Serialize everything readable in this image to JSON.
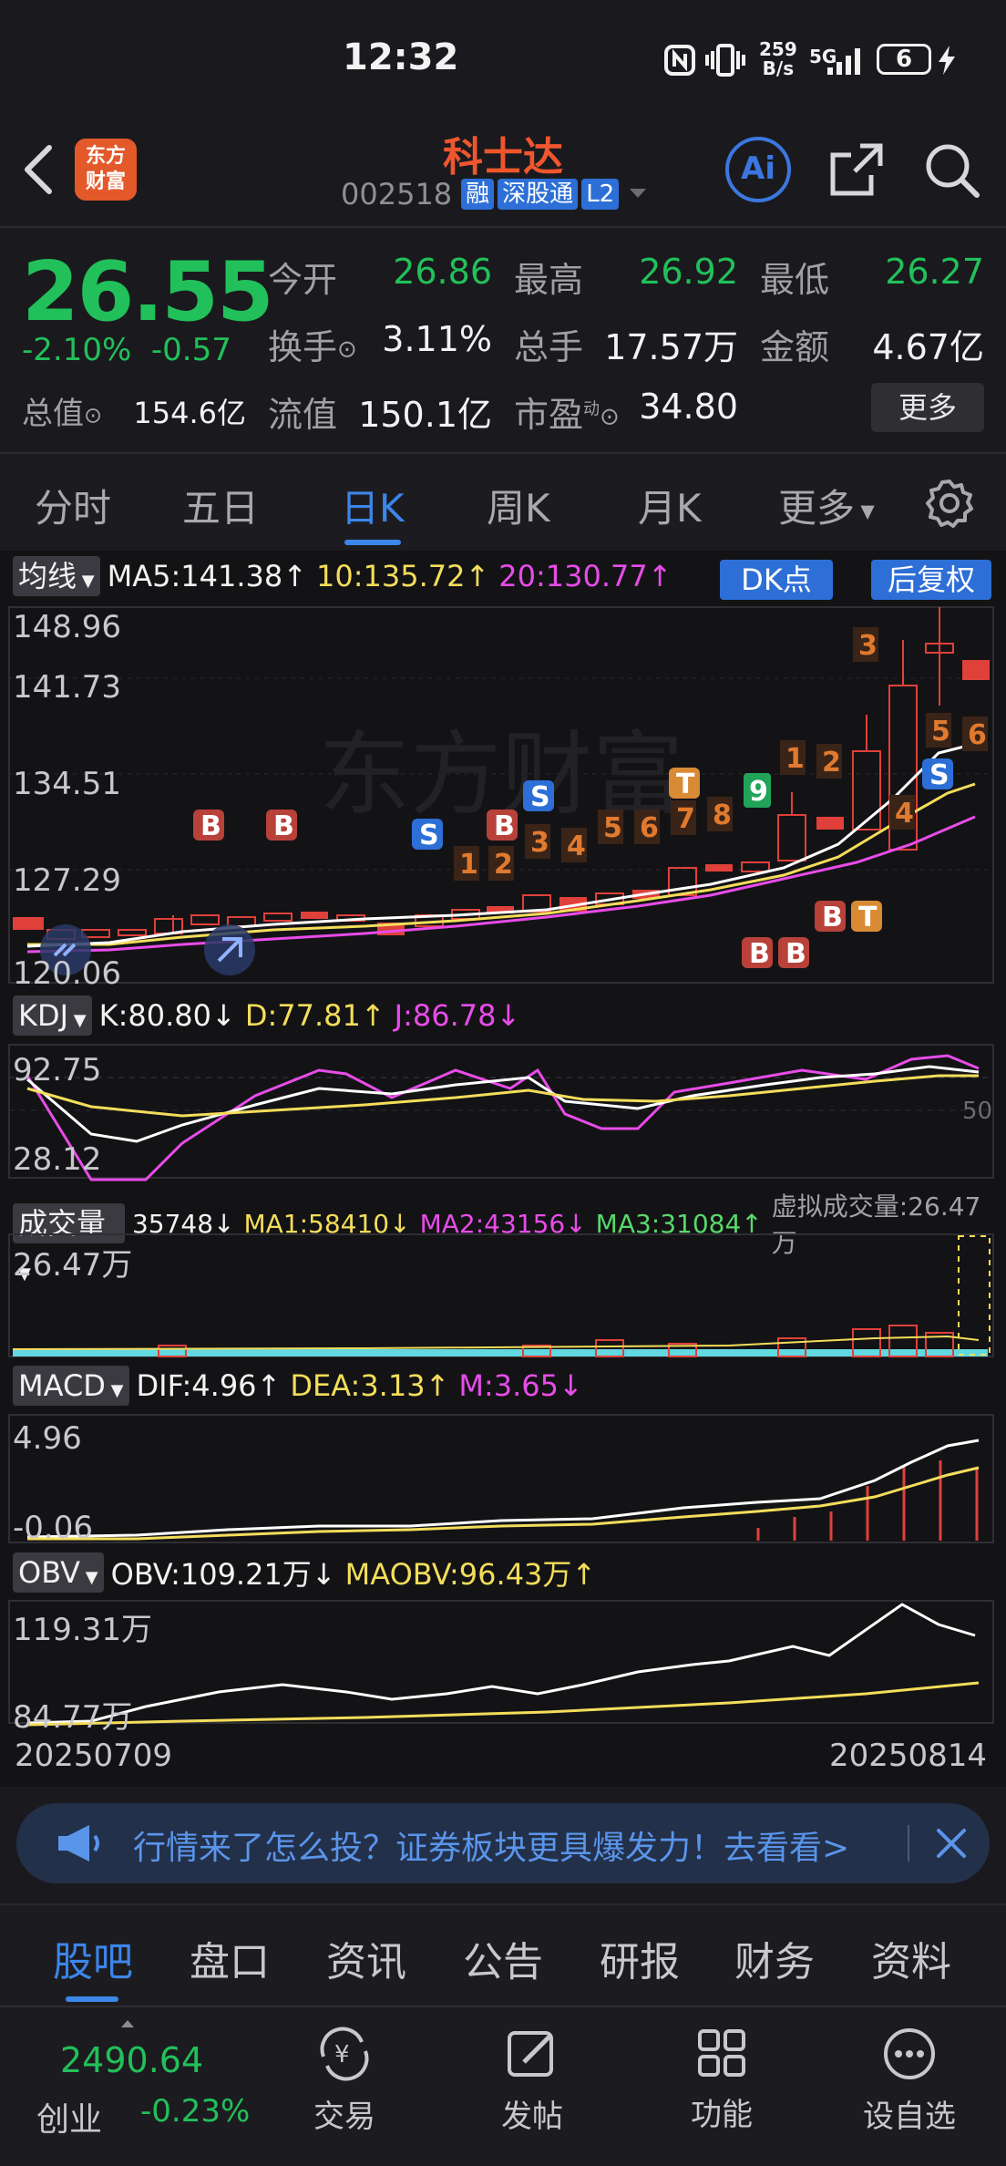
{
  "status": {
    "time": "12:32",
    "netspeed_value": "259",
    "netspeed_unit": "B/s",
    "network": "5G",
    "battery": "6"
  },
  "header": {
    "logo_line1": "东方",
    "logo_line2": "财富",
    "stock_name": "科士达",
    "stock_code": "002518",
    "tags": [
      "融",
      "深股通",
      "L2"
    ],
    "ai_label": "Ai"
  },
  "quote": {
    "price": "26.55",
    "change_pct": "-2.10%",
    "change_amt": "-0.57",
    "open_label": "今开",
    "open": "26.86",
    "high_label": "最高",
    "high": "26.92",
    "low_label": "最低",
    "low": "26.27",
    "turnover_label": "换手",
    "turnover": "3.11%",
    "volume_label": "总手",
    "volume": "17.57万",
    "amount_label": "金额",
    "amount": "4.67亿",
    "mktcap_label": "总值",
    "mktcap": "154.6亿",
    "float_label": "流值",
    "float_cap": "150.1亿",
    "pe_label": "市盈",
    "pe_sup": "动",
    "pe": "34.80",
    "more_label": "更多"
  },
  "tabs": {
    "items": [
      "分时",
      "五日",
      "日K",
      "周K",
      "月K",
      "更多"
    ],
    "active": "日K"
  },
  "indicators": {
    "ma": {
      "select": "均线",
      "ma5": "MA5:141.38↑",
      "ma10": "10:135.72↑",
      "ma20": "20:130.77↑",
      "dk": "DK点",
      "adjust": "后复权",
      "y_labels": [
        "148.96",
        "141.73",
        "134.51",
        "127.29",
        "120.06"
      ]
    },
    "kdj": {
      "select": "KDJ",
      "k": "K:80.80↓",
      "d": "D:77.81↑",
      "j": "J:86.78↓",
      "y_labels": [
        "92.75",
        "28.12"
      ],
      "right_labels": [
        "50"
      ]
    },
    "vol": {
      "select": "成交量",
      "v": "35748↓",
      "ma1": "MA1:58410↓",
      "ma2": "MA2:43156↓",
      "ma3": "MA3:31084↑",
      "virtual": "虚拟成交量:26.47万",
      "y_label": "26.47万"
    },
    "macd": {
      "select": "MACD",
      "dif": "DIF:4.96↑",
      "dea": "DEA:3.13↑",
      "m": "M:3.65↓",
      "y_labels": [
        "4.96",
        "-0.06"
      ]
    },
    "obv": {
      "select": "OBV",
      "obv": "OBV:109.21万↓",
      "maobv": "MAOBV:96.43万↑",
      "y_labels": [
        "119.31万",
        "84.77万"
      ]
    },
    "dates": {
      "start": "20250709",
      "end": "20250814"
    },
    "watermark": "东方财富"
  },
  "banner": {
    "text": "行情来了怎么投？证券板块更具爆发力！去看看>"
  },
  "info_tabs": {
    "items": [
      "股吧",
      "盘口",
      "资讯",
      "公告",
      "研报",
      "财务",
      "资料"
    ],
    "active": "股吧"
  },
  "bottom_nav": {
    "index_value": "2490.64",
    "index_name": "创业",
    "index_change": "-0.23%",
    "items": [
      "交易",
      "发帖",
      "功能",
      "设自选"
    ]
  },
  "colors": {
    "up": "#e0403a",
    "down": "#22c05a",
    "accent": "#3c86ea",
    "brand": "#e4592a",
    "ma5": "#ffffff",
    "ma10": "#f4dd5a",
    "ma20": "#e84ce8"
  }
}
